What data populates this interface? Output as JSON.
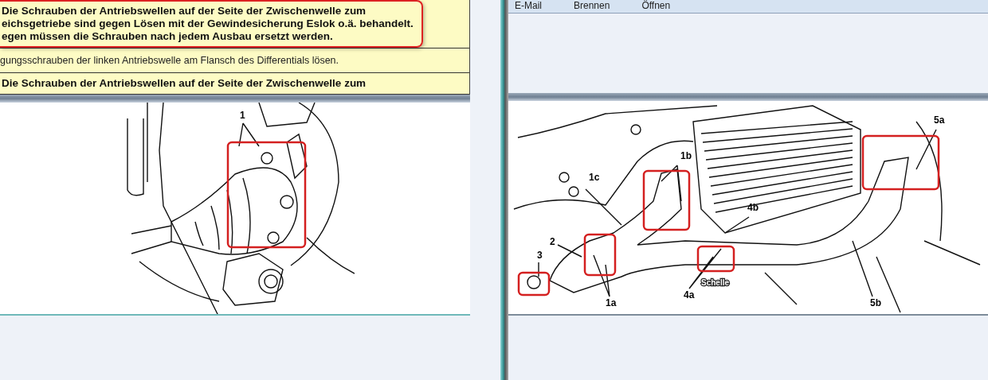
{
  "left_pane": {
    "rows": [
      {
        "kind": "note",
        "text": "Die Schrauben der Antriebswellen auf der Seite der Zwischenwelle zum\neichsgetriebe sind gegen Lösen mit der Gewindesicherung Eslok o.ä. behandelt.\negen müssen die Schrauben nach jedem Ausbau ersetzt werden."
      },
      {
        "kind": "step",
        "text": "gungsschrauben der linken Antriebswelle am Flansch des Differentials lösen."
      },
      {
        "kind": "note_cut",
        "text": "Die Schrauben der Antriebswellen auf der Seite der Zwischenwelle zum"
      }
    ],
    "figure": {
      "callouts": [
        "1"
      ]
    }
  },
  "right_pane": {
    "toolbar": [
      "E-Mail",
      "Brennen",
      "Öffnen"
    ],
    "figure": {
      "callouts": [
        "5a",
        "1b",
        "1c",
        "4b",
        "2",
        "3",
        "1a",
        "4a",
        "5b"
      ],
      "tag": "Schelle"
    }
  }
}
